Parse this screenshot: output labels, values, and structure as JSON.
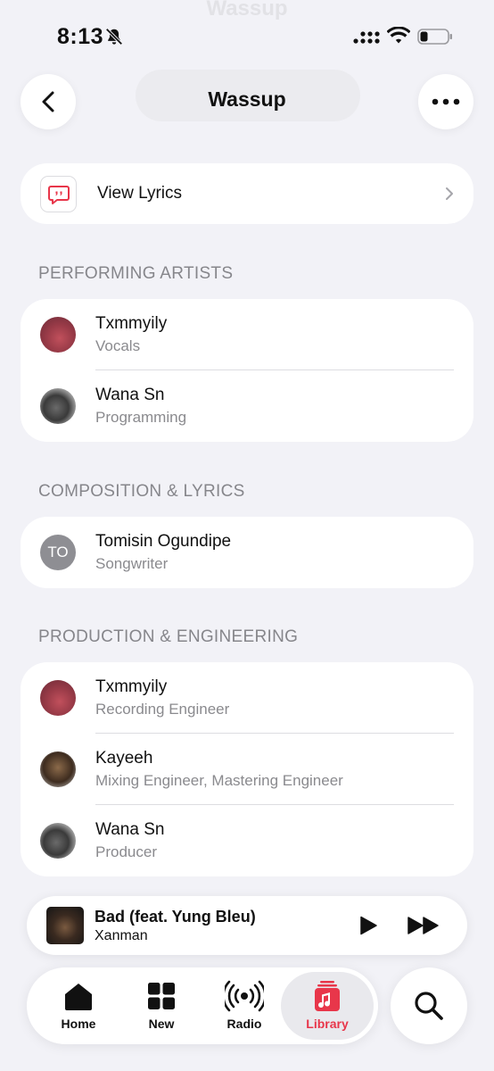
{
  "status_bar": {
    "time": "8:13"
  },
  "header": {
    "title": "Wassup"
  },
  "lyrics": {
    "label": "View Lyrics"
  },
  "sections": {
    "performing": {
      "heading": "PERFORMING ARTISTS",
      "people": [
        {
          "name": "Txmmyily",
          "role": "Vocals"
        },
        {
          "name": "Wana Sn",
          "role": "Programming"
        }
      ]
    },
    "composition": {
      "heading": "COMPOSITION & LYRICS",
      "people": [
        {
          "name": "Tomisin Ogundipe",
          "role": "Songwriter",
          "initials": "TO"
        }
      ]
    },
    "production": {
      "heading": "PRODUCTION & ENGINEERING",
      "people": [
        {
          "name": "Txmmyily",
          "role": "Recording Engineer"
        },
        {
          "name": "Kayeeh",
          "role": "Mixing Engineer, Mastering Engineer"
        },
        {
          "name": "Wana Sn",
          "role": "Producer"
        }
      ]
    }
  },
  "now_playing": {
    "title": "Bad (feat. Yung Bleu)",
    "artist": "Xanman"
  },
  "tabs": [
    {
      "label": "Home",
      "icon": "home-icon"
    },
    {
      "label": "New",
      "icon": "grid-icon"
    },
    {
      "label": "Radio",
      "icon": "radio-icon"
    },
    {
      "label": "Library",
      "icon": "library-icon",
      "active": true
    }
  ],
  "colors": {
    "accent": "#e8364a",
    "background": "#f2f2f7",
    "secondary_text": "#8a8a8e"
  }
}
